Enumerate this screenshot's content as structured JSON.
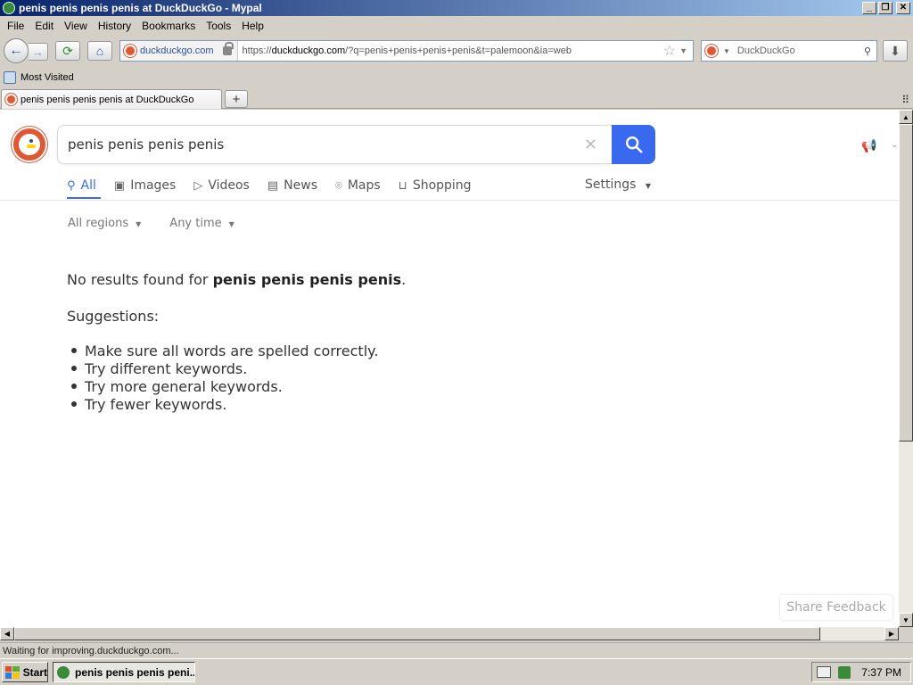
{
  "window": {
    "title": "penis penis penis penis at DuckDuckGo - Mypal",
    "buttons": {
      "minimize": "_",
      "maximize": "❐",
      "close": "✕"
    }
  },
  "menu": [
    "File",
    "Edit",
    "View",
    "History",
    "Bookmarks",
    "Tools",
    "Help"
  ],
  "nav": {
    "back": "←",
    "forward": "→",
    "reload": "⟳",
    "home": "⌂",
    "identity_domain": "duckduckgo.com",
    "url_prefix": "https://",
    "url_domain": "duckduckgo.com",
    "url_path": "/?q=penis+penis+penis+penis&t=palemoon&ia=web",
    "bookmark_star": "☆",
    "url_dropdown": "▼",
    "search_engine": "DuckDuckGo",
    "search_icon": "⚲",
    "download": "⬇"
  },
  "bookmarks": {
    "most_visited": "Most Visited"
  },
  "tabs": {
    "active_tab": "penis penis penis penis at DuckDuckGo",
    "new_tab": "+",
    "menu": "⠿"
  },
  "page": {
    "query": "penis penis penis penis",
    "clear": "✕",
    "megaphone": "📢",
    "megaphone_caret": "⌄",
    "search_tabs": [
      {
        "icon": "⚲",
        "label": "All"
      },
      {
        "icon": "▣",
        "label": "Images"
      },
      {
        "icon": "▷",
        "label": "Videos"
      },
      {
        "icon": "▤",
        "label": "News"
      },
      {
        "icon": "⌾",
        "label": "Maps"
      },
      {
        "icon": "⊔",
        "label": "Shopping"
      }
    ],
    "settings": "Settings",
    "filters": {
      "region": "All regions",
      "time": "Any time",
      "caret": "▼"
    },
    "no_results_prefix": "No results found for ",
    "no_results_query": "penis penis penis penis",
    "no_results_suffix": ".",
    "suggestions_title": "Suggestions:",
    "suggestions": [
      "Make sure all words are spelled correctly.",
      "Try different keywords.",
      "Try more general keywords.",
      "Try fewer keywords."
    ],
    "feedback": "Share Feedback",
    "accent_color": "#3969ef",
    "brand_color": "#de5833"
  },
  "scrollbar": {
    "up": "▲",
    "down": "▼",
    "left": "◀",
    "right": "▶"
  },
  "status": "Waiting for improving.duckduckgo.com...",
  "taskbar": {
    "start": "Start",
    "task": "penis penis penis peni...",
    "clock": "7:37 PM"
  }
}
